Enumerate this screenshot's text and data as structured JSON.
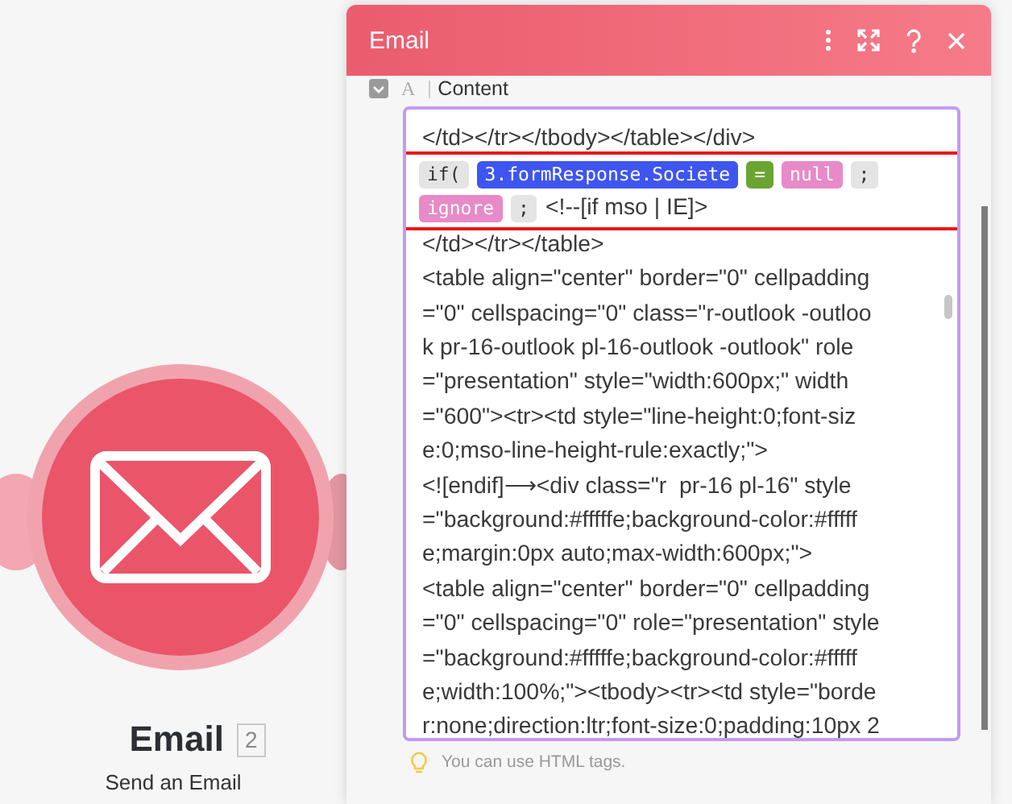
{
  "node": {
    "title": "Email",
    "badge": "2",
    "subtitle": "Send an Email"
  },
  "panel": {
    "title": "Email",
    "field": {
      "type_badge": "A",
      "label": "Content",
      "lines_before": [
        [
          {
            "kind": "text",
            "text": "</td></tr></tbody></table></div>"
          }
        ]
      ],
      "highlighted_lines": [
        [
          {
            "kind": "chip",
            "text": "if(",
            "color": "#e4e4e4"
          },
          {
            "kind": "chip",
            "text": "3.formResponse.Societe",
            "color": "#3f55f0"
          },
          {
            "kind": "chip",
            "text": "=",
            "color": "#6aa431"
          },
          {
            "kind": "chip",
            "text": "null",
            "color": "#e88ac8"
          },
          {
            "kind": "chip",
            "text": ";",
            "color": "#e4e4e4"
          }
        ],
        [
          {
            "kind": "chip",
            "text": "ignore",
            "color": "#e88ac8"
          },
          {
            "kind": "chip",
            "text": ";",
            "color": "#e4e4e4"
          },
          {
            "kind": "text",
            "text": "<!--[if mso | IE]>"
          }
        ]
      ],
      "lines_after": [
        [
          {
            "kind": "text",
            "text": "</td></tr></table>"
          }
        ],
        [
          {
            "kind": "text",
            "text": "<table align=\"center\" border=\"0\" cellpadding"
          }
        ],
        [
          {
            "kind": "text",
            "text": "=\"0\" cellspacing=\"0\" class=\"r-outlook -outloo"
          }
        ],
        [
          {
            "kind": "text",
            "text": "k pr-16-outlook pl-16-outlook -outlook\" role"
          }
        ],
        [
          {
            "kind": "text",
            "text": "=\"presentation\" style=\"width:600px;\" width"
          }
        ],
        [
          {
            "kind": "text",
            "text": "=\"600\"><tr><td style=\"line-height:0;font-siz"
          }
        ],
        [
          {
            "kind": "text",
            "text": "e:0;mso-line-height-rule:exactly;\">"
          }
        ],
        [
          {
            "kind": "text",
            "text": "<![endif]⟶<div class=\"r  pr-16 pl-16\" style"
          }
        ],
        [
          {
            "kind": "text",
            "text": "=\"background:#fffffe;background-color:#fffff"
          }
        ],
        [
          {
            "kind": "text",
            "text": "e;margin:0px auto;max-width:600px;\">"
          }
        ],
        [
          {
            "kind": "text",
            "text": "<table align=\"center\" border=\"0\" cellpadding"
          }
        ],
        [
          {
            "kind": "text",
            "text": "=\"0\" cellspacing=\"0\" role=\"presentation\" style"
          }
        ],
        [
          {
            "kind": "text",
            "text": "=\"background:#fffffe;background-color:#fffff"
          }
        ],
        [
          {
            "kind": "text",
            "text": "e;width:100%;\"><tbody><tr><td style=\"borde"
          }
        ],
        [
          {
            "kind": "text",
            "text": "r:none;direction:ltr;font-size:0;padding:10px 2"
          }
        ]
      ],
      "hint": "You can use HTML tags."
    }
  }
}
